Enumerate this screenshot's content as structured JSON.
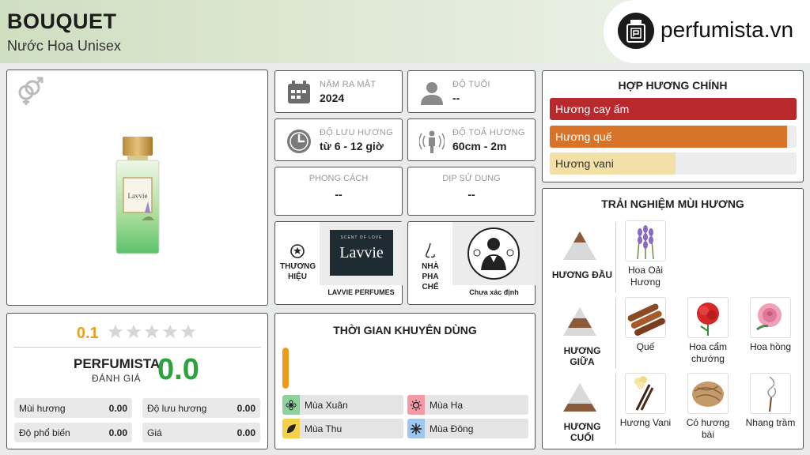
{
  "header": {
    "title": "BOUQUET",
    "subtitle": "Nước Hoa Unisex",
    "logo_text": "perfumista.vn"
  },
  "product": {
    "gender_icon": "gender-unisex-icon"
  },
  "rating": {
    "user_score": "0.1",
    "stars_filled": 0,
    "stars_total": 5,
    "perfumista_label": "PERFUMISTA",
    "perfumista_sub": "ĐÁNH GIÁ",
    "perfumista_score": "0.0",
    "scores": [
      {
        "label": "Mùi hương",
        "value": "0.00"
      },
      {
        "label": "Độ lưu hương",
        "value": "0.00"
      },
      {
        "label": "Độ phổ biến",
        "value": "0.00"
      },
      {
        "label": "Giá",
        "value": "0.00"
      }
    ]
  },
  "info": {
    "release": {
      "label": "NĂM RA MẮT",
      "value": "2024",
      "icon": "calendar-icon"
    },
    "age": {
      "label": "ĐỘ TUỔI",
      "value": "--",
      "icon": "person-icon"
    },
    "longevity": {
      "label": "ĐỘ LƯU HƯƠNG",
      "value": "từ 6 - 12 giờ",
      "icon": "clock-icon"
    },
    "sillage": {
      "label": "ĐỘ TOẢ HƯƠNG",
      "value": "60cm - 2m",
      "icon": "sillage-icon"
    },
    "style": {
      "label": "PHONG CÁCH",
      "value": "--"
    },
    "occasion": {
      "label": "DỊP SỬ DỤNG",
      "value": "--"
    }
  },
  "brand": {
    "label": "THƯƠNG HIỆU",
    "name": "LAVVIE PERFUMES",
    "logo_tagline": "SCENT OF LOVE",
    "logo_word": "Lavvie"
  },
  "perfumer": {
    "label": "NHÀ PHA CHẾ",
    "name": "Chưa xác định"
  },
  "recommended": {
    "title": "THỜI GIAN KHUYÊN DÙNG",
    "seasons": [
      {
        "label": "Mùa Xuân",
        "color": "#8fd19e"
      },
      {
        "label": "Mùa Hạ",
        "color": "#f29ba6"
      },
      {
        "label": "Mùa Thu",
        "color": "#f2d04a"
      },
      {
        "label": "Mùa Đông",
        "color": "#9dc7ef"
      }
    ],
    "bar_color": "#f09a1a",
    "day_level": 1.0
  },
  "accords": {
    "title": "HỢP HƯƠNG CHÍNH",
    "items": [
      {
        "label": "Hương cay ấm",
        "value": 1.0,
        "color": "#b8282c",
        "text_color": "#ffffff"
      },
      {
        "label": "Hương quế",
        "value": 0.96,
        "color": "#d8742a",
        "text_color": "#ffffff"
      },
      {
        "label": "Hương vani",
        "value": 0.51,
        "color": "#f3e0a6",
        "text_color": "#333333"
      }
    ]
  },
  "notes": {
    "title": "TRẢI NGHIỆM MÙI HƯƠNG",
    "top_label": "HƯƠNG ĐẦU",
    "middle_label": "HƯƠNG GIỮA",
    "base_label": "HƯƠNG CUỐI",
    "top": [
      {
        "name": "Hoa Oải Hương",
        "icon": "lavender-icon"
      }
    ],
    "middle": [
      {
        "name": "Quế",
        "icon": "cinnamon-icon"
      },
      {
        "name": "Hoa cẩm chướng",
        "icon": "carnation-icon"
      },
      {
        "name": "Hoa hồng",
        "icon": "rose-icon"
      }
    ],
    "base": [
      {
        "name": "Hương Vani",
        "icon": "vanilla-icon"
      },
      {
        "name": "Cỏ hương bài",
        "icon": "vetiver-icon"
      },
      {
        "name": "Nhang trầm",
        "icon": "incense-icon"
      }
    ]
  }
}
